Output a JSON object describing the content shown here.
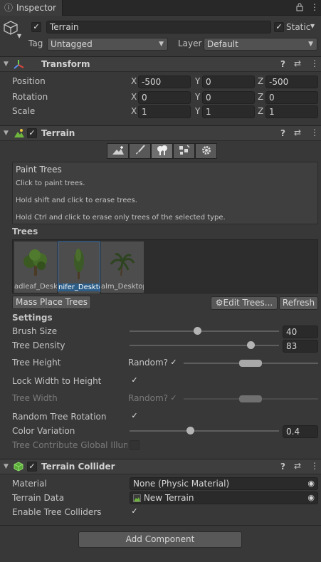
{
  "window": {
    "tab_title": "Inspector"
  },
  "object": {
    "name": "Terrain",
    "static_label": "Static",
    "tag_label": "Tag",
    "tag_value": "Untagged",
    "layer_label": "Layer",
    "layer_value": "Default"
  },
  "transform": {
    "title": "Transform",
    "position_label": "Position",
    "rotation_label": "Rotation",
    "scale_label": "Scale",
    "axis_x": "X",
    "axis_y": "Y",
    "axis_z": "Z",
    "position": {
      "x": "-500",
      "y": "0",
      "z": "-500"
    },
    "rotation": {
      "x": "0",
      "y": "0",
      "z": "0"
    },
    "scale": {
      "x": "1",
      "y": "1",
      "z": "1"
    }
  },
  "terrain": {
    "title": "Terrain",
    "help_title": "Paint Trees",
    "help_lines": [
      "Click to paint trees.",
      "Hold shift and click to erase trees.",
      "Hold Ctrl and click to erase only trees of the selected type."
    ],
    "trees_label": "Trees",
    "trees": [
      {
        "name": "Broadleaf_Desktop",
        "shown": "adleaf_Desk"
      },
      {
        "name": "Conifer_Desktop",
        "shown": "nifer_Deskto"
      },
      {
        "name": "Palm_Desktop",
        "shown": "alm_Desktop"
      }
    ],
    "mass_place_button": "Mass Place Trees",
    "edit_trees_button": "Edit Trees...",
    "refresh_button": "Refresh",
    "settings_label": "Settings",
    "brush_size_label": "Brush Size",
    "brush_size_value": "40",
    "brush_size_fraction": 0.45,
    "tree_density_label": "Tree Density",
    "tree_density_value": "83",
    "tree_density_fraction": 0.83,
    "tree_height_label": "Tree Height",
    "random_label": "Random?",
    "lock_width_label": "Lock Width to Height",
    "tree_width_label": "Tree Width",
    "random_rotation_label": "Random Tree Rotation",
    "color_variation_label": "Color Variation",
    "color_variation_value": "0.4",
    "color_variation_fraction": 0.4,
    "global_illum_label": "Tree Contribute Global Illumir"
  },
  "collider": {
    "title": "Terrain Collider",
    "material_label": "Material",
    "material_value": "None (Physic Material)",
    "terrain_data_label": "Terrain Data",
    "terrain_data_value": "New Terrain",
    "enable_colliders_label": "Enable Tree Colliders"
  },
  "add_component_button": "Add Component",
  "icons": {
    "check": "✓",
    "menu": "⋮",
    "help": "?",
    "settings": "⇄",
    "lock": "🔒",
    "target": "◉"
  }
}
